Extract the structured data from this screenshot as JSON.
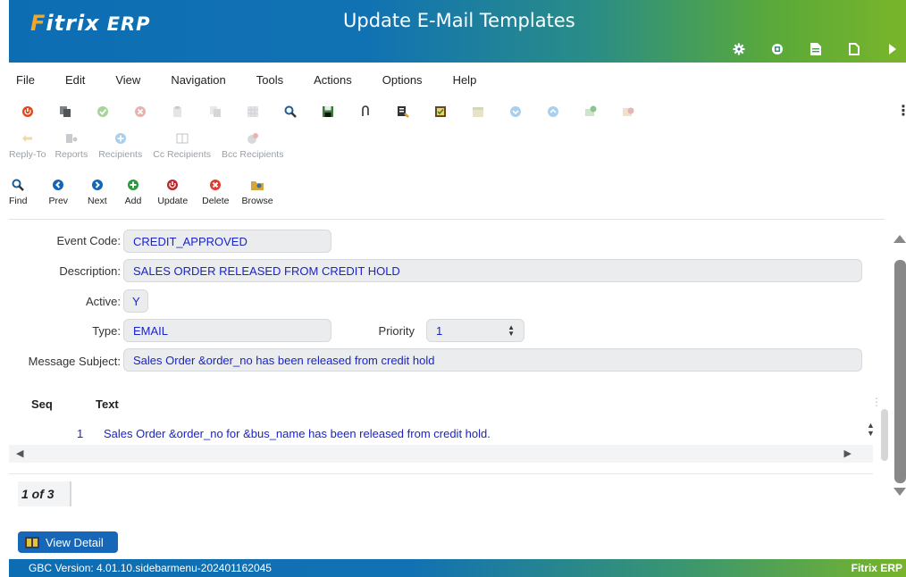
{
  "header": {
    "logo_main": "Fitrix",
    "logo_sub": "ERP",
    "title": "Update E-Mail Templates",
    "icons": [
      "gear-icon",
      "chip-icon",
      "document-icon",
      "blank-page-icon",
      "play-icon"
    ]
  },
  "menu": [
    "File",
    "Edit",
    "View",
    "Navigation",
    "Tools",
    "Actions",
    "Options",
    "Help"
  ],
  "toolbar_secondary": [
    {
      "label": "Reply-To",
      "icon": "reply-icon"
    },
    {
      "label": "Reports",
      "icon": "reports-icon"
    },
    {
      "label": "Recipients",
      "icon": "recipients-icon"
    },
    {
      "label": "Cc Recipients",
      "icon": "cc-recipients-icon"
    },
    {
      "label": "Bcc Recipients",
      "icon": "bcc-recipients-icon"
    }
  ],
  "toolbar_main": [
    {
      "label": "Find",
      "icon": "find-icon"
    },
    {
      "label": "Prev",
      "icon": "prev-icon"
    },
    {
      "label": "Next",
      "icon": "next-icon"
    },
    {
      "label": "Add",
      "icon": "add-icon"
    },
    {
      "label": "Update",
      "icon": "update-icon"
    },
    {
      "label": "Delete",
      "icon": "delete-icon"
    },
    {
      "label": "Browse",
      "icon": "browse-icon"
    }
  ],
  "form": {
    "event_code_label": "Event Code:",
    "event_code": "CREDIT_APPROVED",
    "description_label": "Description:",
    "description": "SALES ORDER RELEASED FROM CREDIT HOLD",
    "active_label": "Active:",
    "active": "Y",
    "type_label": "Type:",
    "type": "EMAIL",
    "priority_label": "Priority",
    "priority": "1",
    "subject_label": "Message Subject:",
    "subject": "Sales Order &order_no has been released from credit hold"
  },
  "table": {
    "headers": [
      "Seq",
      "Text"
    ],
    "rows": [
      {
        "seq": "1",
        "text": "Sales Order &order_no for &bus_name has been released from credit hold."
      }
    ]
  },
  "row_count": "1 of 3",
  "view_detail": "View Detail",
  "status": {
    "version": "GBC Version: 4.01.10.sidebarmenu-202401162045",
    "brand": "Fitrix ERP"
  },
  "colors": {
    "accent": "#1667b8",
    "field_text": "#1a24c8",
    "field_bg": "#ebecee"
  }
}
